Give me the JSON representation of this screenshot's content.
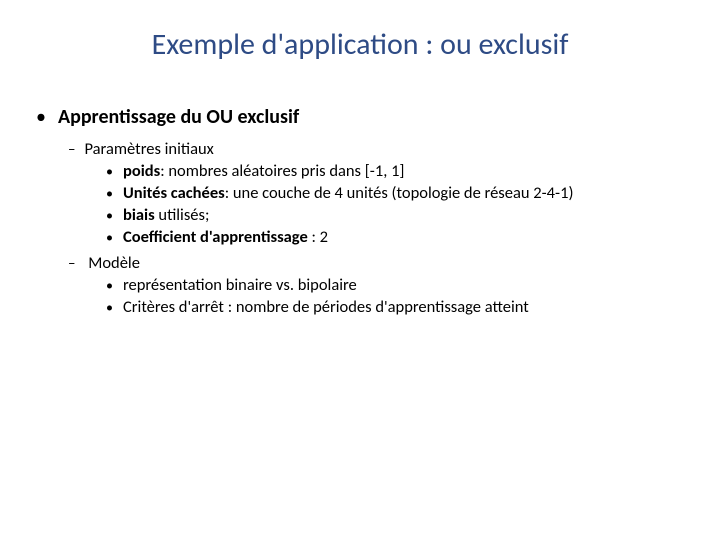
{
  "title": "Exemple d'application : ou exclusif",
  "bullet": {
    "heading": "Apprentissage du OU exclusif",
    "sub1a": {
      "label": "Paramètres initiaux",
      "items": [
        {
          "bold": "poids",
          "rest": ": nombres aléatoires pris dans [-1, 1]"
        },
        {
          "bold": "Unités cachées",
          "rest": ": une couche de 4 unités (topologie de réseau 2-4-1)"
        },
        {
          "bold": "biais",
          "rest": " utilisés;"
        },
        {
          "bold": "Coefficient d'apprentissage",
          "rest": " : 2"
        }
      ]
    },
    "sub1b": {
      "label": "Modèle",
      "items": [
        {
          "text": "représentation binaire vs. bipolaire"
        },
        {
          "text": "Critères d'arrêt : nombre de périodes d'apprentissage atteint"
        }
      ]
    }
  }
}
